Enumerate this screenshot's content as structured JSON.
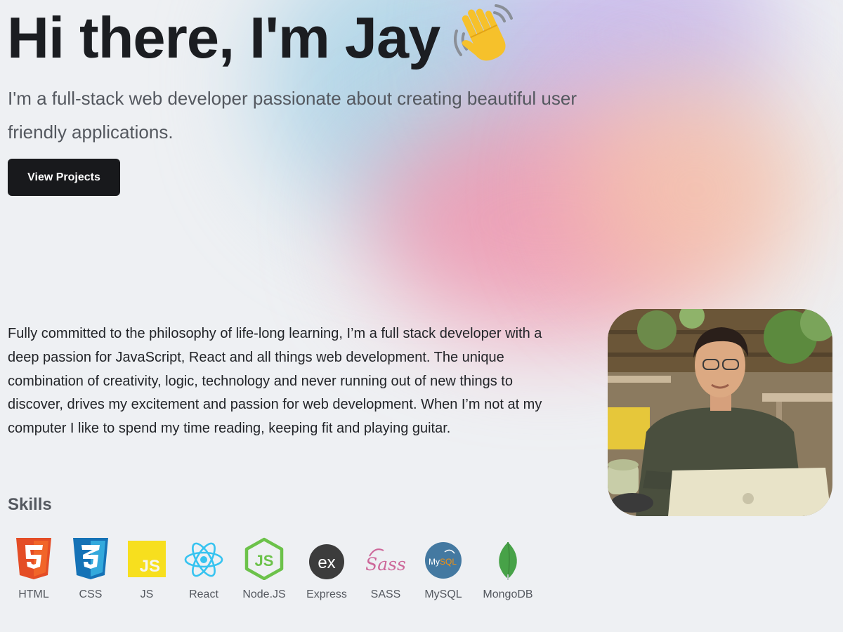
{
  "hero": {
    "title": "Hi there, I'm Jay",
    "wave_icon": "waving-hand-emoji",
    "subtitle": "I'm a full-stack web developer passionate about creating beautiful user friendly applications.",
    "cta_label": "View Projects"
  },
  "about": {
    "text": "Fully committed to the philosophy of life-long learning, I’m a full stack developer with a deep passion for JavaScript, React and all things web development. The unique combination of creativity, logic, technology and never running out of new things to discover, drives my excitement and passion for web development. When I’m not at my computer I like to spend my time reading, keeping fit and playing guitar.",
    "photo_icon": "profile-photo"
  },
  "skills": {
    "heading": "Skills",
    "items": [
      {
        "label": "HTML",
        "icon": "html5-icon",
        "color": "#e44d26"
      },
      {
        "label": "CSS",
        "icon": "css3-icon",
        "color": "#1572b6"
      },
      {
        "label": "JS",
        "icon": "javascript-icon",
        "color": "#f7df1e"
      },
      {
        "label": "React",
        "icon": "react-icon",
        "color": "#61dafb"
      },
      {
        "label": "Node.JS",
        "icon": "nodejs-icon",
        "color": "#6cc24a"
      },
      {
        "label": "Express",
        "icon": "express-icon",
        "color": "#3c3c3c"
      },
      {
        "label": "SASS",
        "icon": "sass-icon",
        "color": "#cd6799"
      },
      {
        "label": "MySQL",
        "icon": "mysql-icon",
        "color": "#4479a1"
      },
      {
        "label": "MongoDB",
        "icon": "mongodb-icon",
        "color": "#47a248"
      }
    ]
  },
  "colors": {
    "background": "#eef0f3",
    "button": "#18191c",
    "text": "#1b1d21",
    "muted": "#54585f"
  }
}
